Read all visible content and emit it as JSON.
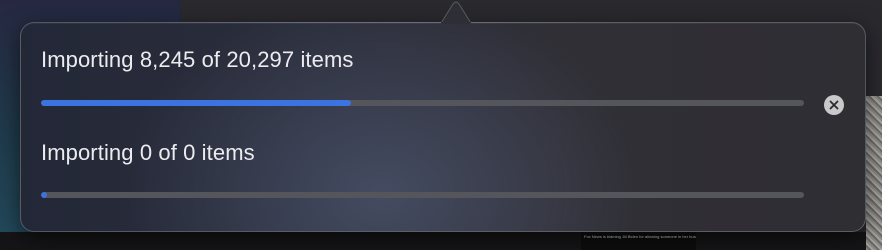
{
  "imports": [
    {
      "title": "Importing 8,245 of 20,297 items",
      "progress_fraction": 0.4062,
      "has_cancel": true,
      "cancel_icon": "close-icon"
    },
    {
      "title": "Importing 0 of 0 items",
      "progress_fraction": 0.0,
      "has_cancel": false
    }
  ],
  "background": {
    "news_thumbnail_text": "Fox News is blaming Jill Biden for allowing someone in her husband's 'mental state' to run for office"
  },
  "colors": {
    "progress_fill": "#3b74e0",
    "progress_track": "#55555c",
    "text": "#ececef"
  }
}
